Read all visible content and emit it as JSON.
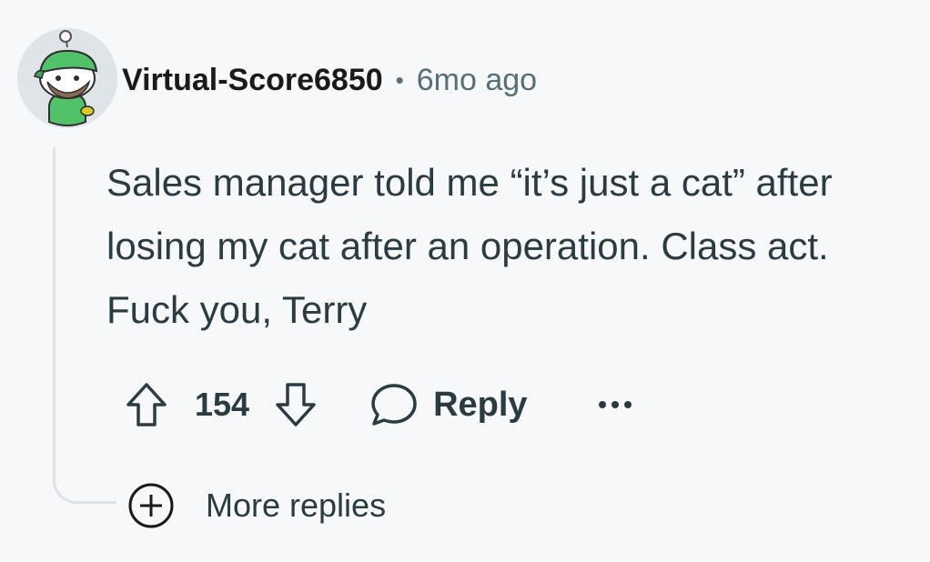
{
  "comment": {
    "author": "Virtual-Score6850",
    "separator": "•",
    "timestamp": "6mo ago",
    "text": "Sales manager told me “it’s just a cat” after losing my cat after an operation. Class act. Fuck you, Terry",
    "score": "154",
    "reply_label": "Reply",
    "more_replies_label": "More replies"
  },
  "icons": {
    "avatar": "snoo-avatar-green-cap",
    "upvote": "arrow-up-outline-icon",
    "downvote": "arrow-down-outline-icon",
    "reply": "speech-bubble-icon",
    "overflow": "ellipsis-icon",
    "expand": "plus-circle-icon"
  },
  "colors": {
    "background": "#f7f8fa",
    "text_primary": "#1a1a1b",
    "text_secondary": "#576f76",
    "thread_line": "#dde2e6",
    "avatar_bg": "#dfe4e8",
    "avatar_cap": "#52c26a"
  }
}
